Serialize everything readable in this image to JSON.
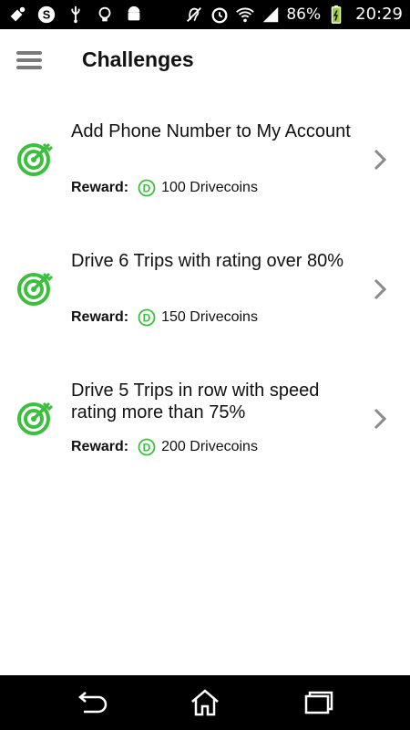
{
  "status_bar": {
    "left_icons": [
      "mouse-notification-icon",
      "skype-icon",
      "usb-icon",
      "bulb-icon",
      "android-debug-icon"
    ],
    "right_icons": [
      "hearing-aid-icon",
      "alarm-icon",
      "wifi-icon",
      "signal-icon",
      "battery-icon"
    ],
    "battery_percent": "86%",
    "time": "20:29"
  },
  "header": {
    "menu_icon": "menu-icon",
    "title": "Challenges"
  },
  "challenges": [
    {
      "title": "Add Phone Number to My Account",
      "reward_label": "Reward:",
      "reward_value": "100 Drivecoins",
      "icon": "target-icon"
    },
    {
      "title": "Drive 6 Trips with rating over 80%",
      "reward_label": "Reward:",
      "reward_value": "150 Drivecoins",
      "icon": "target-icon"
    },
    {
      "title": "Drive 5 Trips in row with speed rating more than 75%",
      "reward_label": "Reward:",
      "reward_value": "200 Drivecoins",
      "icon": "target-icon"
    }
  ],
  "nav_bar": {
    "buttons": [
      "back-icon",
      "home-icon",
      "recent-apps-icon"
    ]
  },
  "colors": {
    "accent_green": "#3cbf3c",
    "chevron_gray": "#8a8a8a",
    "status_bar_bg": "#000000",
    "battery_green": "#9ccc3c"
  }
}
